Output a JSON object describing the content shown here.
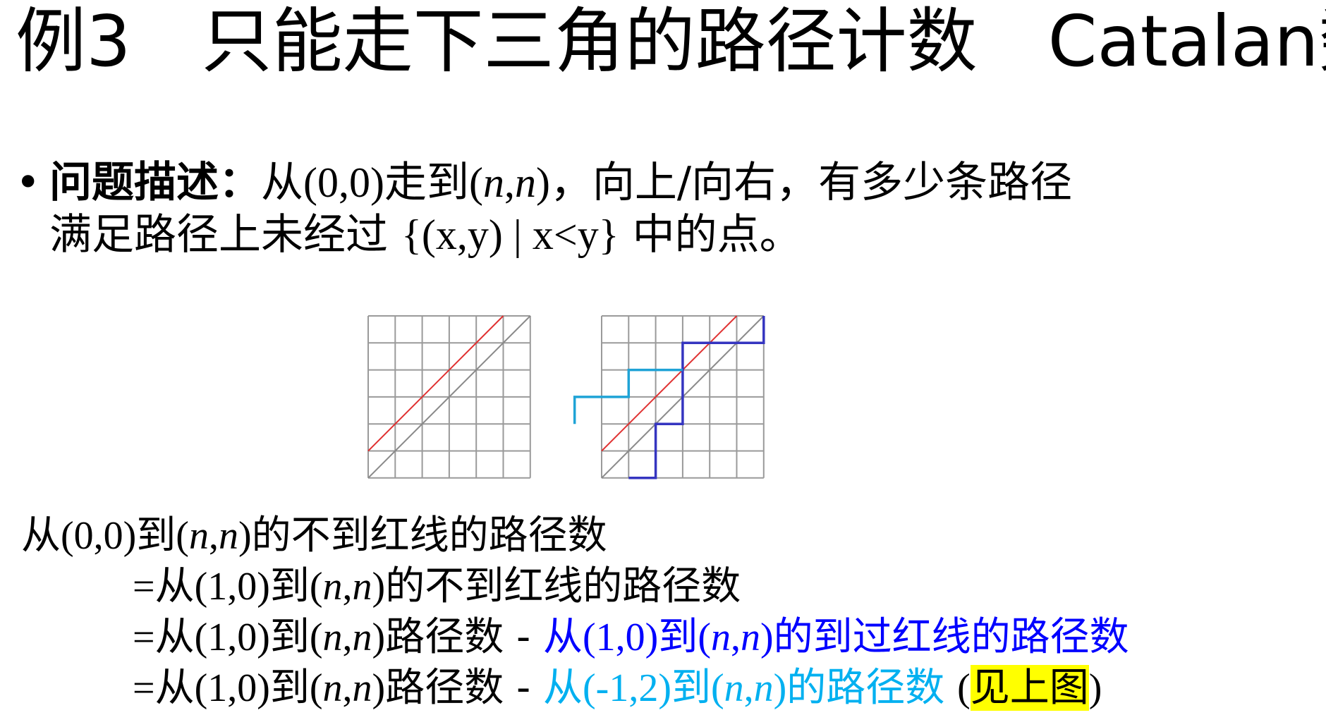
{
  "title": {
    "prefix": "例3",
    "main": "只能走下三角的路径计数",
    "suffix": "Catalan数"
  },
  "problem": {
    "bullet": "•",
    "label": "问题描述：",
    "line1_a": "从",
    "line1_b": "(0,0)",
    "line1_c": "走到",
    "line1_d": "(",
    "line1_n1": "n",
    "line1_e": ",",
    "line1_n2": "n",
    "line1_f": ")",
    "line1_g": "，向上/向右，有多少条路径",
    "line2_a": "满足路径上未经过 ",
    "line2_b": "{(x,y) | x<y}",
    "line2_c": " 中的点。"
  },
  "equations": {
    "l1": {
      "t1": "从",
      "s1": "(0,0)",
      "t2": "到",
      "s2": "(",
      "n1": "n",
      "s3": ",",
      "n2": "n",
      "s4": ")",
      "t3": "的不到红线的路径数"
    },
    "l2": {
      "s0": "=",
      "t1": "从",
      "s1": "(1,0)",
      "t2": "到",
      "s2": "(",
      "n1": "n",
      "s3": ",",
      "n2": "n",
      "s4": ")",
      "t3": "的不到红线的路径数"
    },
    "l3": {
      "s0": "=",
      "t1": "从",
      "s1": "(1,0)",
      "t2": "到",
      "s2": "(",
      "n1": "n",
      "s3": ",",
      "n2": "n",
      "s4": ")",
      "t3": "路径数 ",
      "s5": " - ",
      "b_t1": "从",
      "b_s1": "(1,0)",
      "b_t2": "到",
      "b_s2": "(",
      "b_n1": "n",
      "b_s3": ",",
      "b_n2": "n",
      "b_s4": ")",
      "b_t3": "的到过红线的路径数"
    },
    "l4": {
      "s0": "=",
      "t1": "从",
      "s1": "(1,0)",
      "t2": "到",
      "s2": "(",
      "n1": "n",
      "s3": ",",
      "n2": "n",
      "s4": ")",
      "t3": "路径数 ",
      "s5": " - ",
      "c_t1": "从",
      "c_s1": "(-1,2)",
      "c_t2": "到",
      "c_s2": "(",
      "c_n1": "n",
      "c_s3": ",",
      "c_n2": "n",
      "c_s4": ")",
      "c_t3": "的路径数 ",
      "p_open": "(",
      "hl": "见上图",
      "p_close": ")"
    }
  },
  "colors": {
    "grid": "#9a9a9a",
    "diagonal": "#8a8a8a",
    "red_line": "#e03030",
    "path_blue": "#3535c0",
    "path_cyan": "#1fa3d6",
    "text_blue": "#0000ff",
    "text_cyan": "#00b0f0",
    "highlight": "#ffff00"
  }
}
